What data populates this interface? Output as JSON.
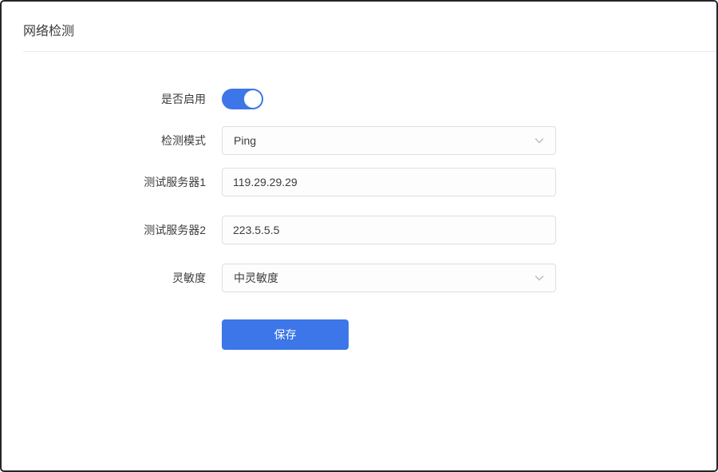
{
  "header": {
    "title": "网络检测"
  },
  "form": {
    "enable": {
      "label": "是否启用",
      "state": "on"
    },
    "mode": {
      "label": "检测模式",
      "value": "Ping"
    },
    "server1": {
      "label": "测试服务器1",
      "value": "119.29.29.29"
    },
    "server2": {
      "label": "测试服务器2",
      "value": "223.5.5.5"
    },
    "sensitivity": {
      "label": "灵敏度",
      "value": "中灵敏度"
    },
    "save_label": "保存"
  },
  "icons": {
    "dropdown": "chevron-down-icon"
  },
  "colors": {
    "accent_blue": "#3d76e9",
    "field_border": "#dcdfe6",
    "field_background": "#fdfdfe",
    "label_text": "#3d3d3d",
    "divider": "#e7e9ec",
    "chevron": "#c0c4cc",
    "window_border": "#26262a"
  }
}
